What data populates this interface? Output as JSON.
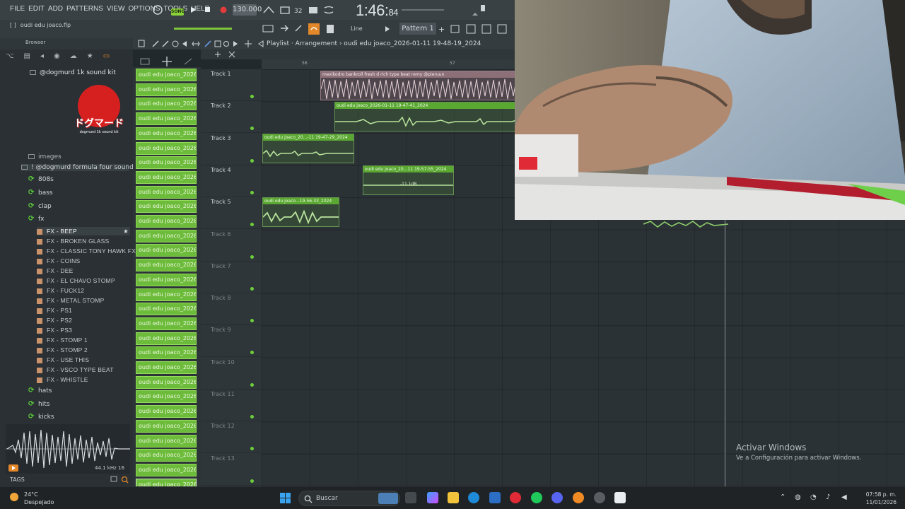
{
  "menu": [
    "FILE",
    "EDIT",
    "ADD",
    "PATTERNS",
    "VIEW",
    "OPTIONS",
    "TOOLS",
    "HELP"
  ],
  "transport": {
    "mode_badge": "SONG",
    "tempo": "130.000",
    "time_main": "1:46:",
    "time_sub": "84"
  },
  "project_file": "oudi edu joaco.flp",
  "line_mode": "Line",
  "pattern": "Pattern 1",
  "browser": {
    "header": "Browser",
    "pack_title": "@dogmurd 1k sound kit",
    "logo_text": "ドグマード",
    "logo_sub": "dogmurd 1k sound kit",
    "images_label": "images",
    "formula_pack": "! @dogmurd formula four sound kit",
    "folders_top": [
      "808s",
      "bass",
      "clap",
      "fx"
    ],
    "selected_file": "FX - BEEP",
    "fx_files": [
      "FX - BROKEN GLASS",
      "FX - CLASSIC TONY HAWK FX",
      "FX - COINS",
      "FX - DEE",
      "FX - EL CHAVO STOMP",
      "FX - FUCK12",
      "FX - METAL STOMP",
      "FX - PS1",
      "FX - PS2",
      "FX - PS3",
      "FX - STOMP 1",
      "FX - STOMP 2",
      "FX - USE THIS",
      "FX - VSCO TYPE BEAT",
      "FX - WHISTLE"
    ],
    "folders_bottom": [
      "hats",
      "hits",
      "kicks"
    ],
    "sample_rate": "44.1 kHz 16",
    "tags_label": "TAGS"
  },
  "channels": {
    "label": "oudi edu joaco_2026-01...",
    "count": 29
  },
  "playlist": {
    "title": "Playlist · Arrangement › oudi edu joaco_2026-01-11 19-48-19_2024",
    "ruler": [
      "56",
      "57"
    ],
    "tracks": [
      "Track 1",
      "Track 2",
      "Track 3",
      "Track 4",
      "Track 5",
      "Track 6",
      "Track 7",
      "Track 8",
      "Track 9",
      "Track 10",
      "Track 11",
      "Track 12",
      "Track 13"
    ],
    "clips": [
      {
        "title": "mexikodro  bankroll fresh  d rich type beat remy @pieruun",
        "style": "pink"
      },
      {
        "title": "oudi edu joaco_2026-01-11 19-47-41_2024",
        "style": "green"
      },
      {
        "title": "oudi edu joaco_20...-11 19-47-29_2024",
        "style": "green"
      },
      {
        "title": "oudi edu joaco_20...11 19-57-55_2024",
        "style": "green",
        "value": "-11.1dB"
      },
      {
        "title": "oudi edu joaco...19-56-33_2024",
        "style": "green"
      }
    ]
  },
  "activation": {
    "title": "Activar Windows",
    "subtitle": "Ve a Configuración para activar Windows."
  },
  "taskbar": {
    "weather_temp": "24°C",
    "weather_desc": "Despejado",
    "search_placeholder": "Buscar",
    "time": "07:58 p. m.",
    "date": "11/01/2026"
  },
  "colors": {
    "accent_green": "#6dbb3a",
    "record_red": "#d62020"
  }
}
